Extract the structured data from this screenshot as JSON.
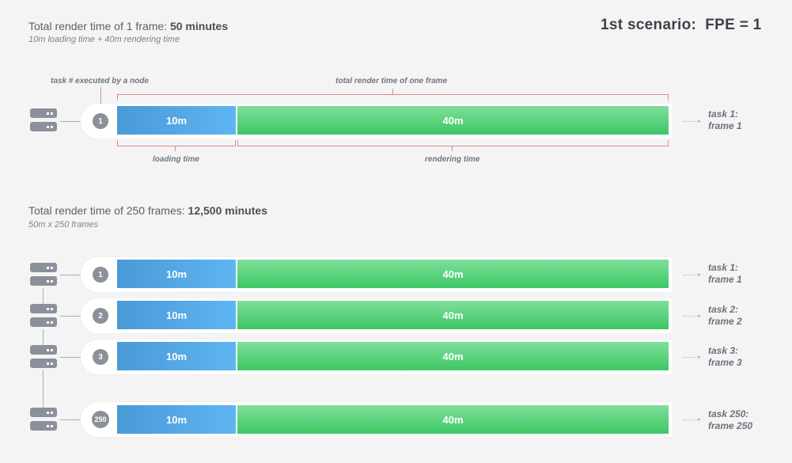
{
  "header1": {
    "title_prefix": "Total render time of 1 frame: ",
    "title_value": "50 minutes",
    "subtitle": "10m loading time + 40m rendering time"
  },
  "scenario": "1st scenario:  FPE = 1",
  "annotations": {
    "task_executed": "task # executed by a node",
    "total_render": "total render time of one frame",
    "loading_time": "loading time",
    "rendering_time": "rendering time"
  },
  "top_row": {
    "badge": "1",
    "load_label": "10m",
    "render_label": "40m",
    "task": "task 1:",
    "frame": "frame 1"
  },
  "header2": {
    "title_prefix": "Total render time of 250 frames: ",
    "title_value": "12,500 minutes",
    "subtitle": "50m x 250 frames"
  },
  "rows": [
    {
      "badge": "1",
      "load_label": "10m",
      "render_label": "40m",
      "task": "task 1:",
      "frame": "frame 1"
    },
    {
      "badge": "2",
      "load_label": "10m",
      "render_label": "40m",
      "task": "task 2:",
      "frame": "frame 2"
    },
    {
      "badge": "3",
      "load_label": "10m",
      "render_label": "40m",
      "task": "task 3:",
      "frame": "frame 3"
    },
    {
      "badge": "250",
      "load_label": "10m",
      "render_label": "40m",
      "task": "task 250:",
      "frame": "frame 250"
    }
  ],
  "colors": {
    "loading": "#4fa6e4",
    "rendering": "#4fd071",
    "badge": "#8b909a",
    "bracket": "#e2879a"
  },
  "icons": {
    "node": "server-icon"
  }
}
